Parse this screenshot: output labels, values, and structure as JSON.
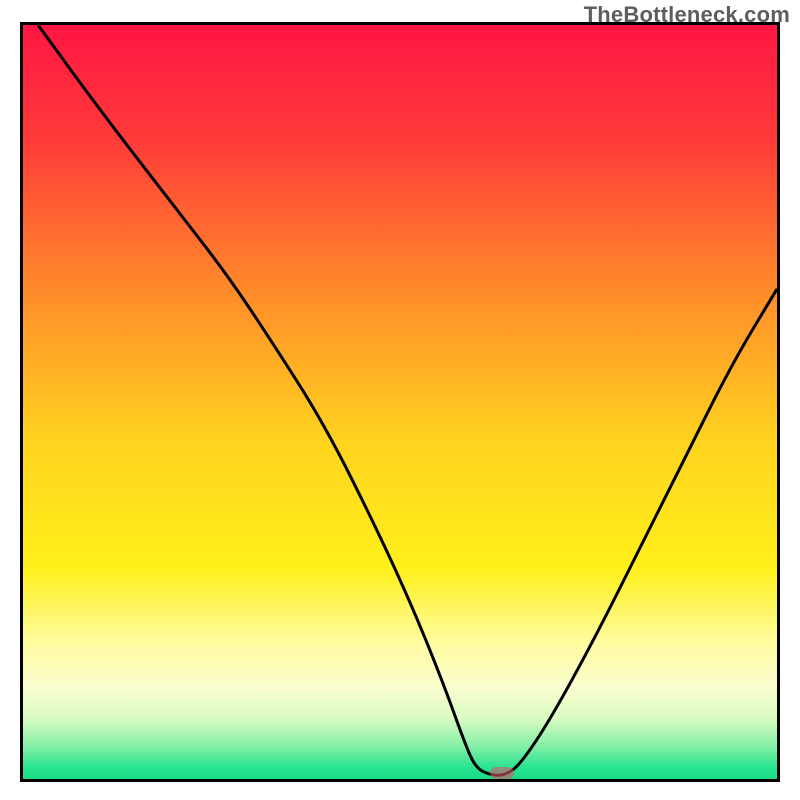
{
  "watermark": "TheBottleneck.com",
  "chart_data": {
    "type": "line",
    "title": "",
    "xlabel": "",
    "ylabel": "",
    "xlim": [
      0,
      100
    ],
    "ylim": [
      0,
      100
    ],
    "grid": false,
    "legend": false,
    "gradient_stops": [
      {
        "offset": 0.0,
        "color": "#ff1643"
      },
      {
        "offset": 0.15,
        "color": "#ff3a3a"
      },
      {
        "offset": 0.35,
        "color": "#ff8a2a"
      },
      {
        "offset": 0.55,
        "color": "#ffd21f"
      },
      {
        "offset": 0.72,
        "color": "#fff01a"
      },
      {
        "offset": 0.82,
        "color": "#fffca0"
      },
      {
        "offset": 0.88,
        "color": "#fafdd0"
      },
      {
        "offset": 0.92,
        "color": "#d8fbc0"
      },
      {
        "offset": 0.955,
        "color": "#88f0a8"
      },
      {
        "offset": 0.985,
        "color": "#28e38f"
      },
      {
        "offset": 1.0,
        "color": "#18db86"
      }
    ],
    "series": [
      {
        "name": "bottleneck-curve",
        "color": "#000000",
        "x": [
          2,
          10,
          20,
          27,
          33,
          40,
          47,
          52,
          56,
          58.5,
          60,
          62,
          64,
          66,
          70,
          76,
          82,
          88,
          94,
          100
        ],
        "y": [
          100,
          89,
          76,
          67,
          58,
          47,
          33,
          22,
          12,
          5,
          1.5,
          0.5,
          0.5,
          2,
          8,
          19,
          31,
          43,
          55,
          65
        ]
      }
    ],
    "marker": {
      "x": 63.5,
      "y": 0.8,
      "color": "#d9576b"
    }
  }
}
